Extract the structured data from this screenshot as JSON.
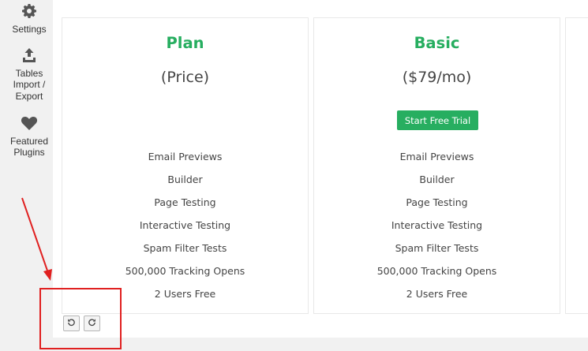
{
  "sidebar": {
    "items": [
      {
        "label": "Settings",
        "icon": "gear-icon"
      },
      {
        "label": "Tables\nImport /\nExport",
        "icon": "upload-icon"
      },
      {
        "label": "Featured\nPlugins",
        "icon": "heart-icon"
      }
    ]
  },
  "pricing": {
    "columns": [
      {
        "title": "Plan",
        "price": "(Price)",
        "features": [
          "Email Previews",
          "Builder",
          "Page Testing",
          "Interactive Testing",
          "Spam Filter Tests",
          "500,000 Tracking Opens",
          "2 Users Free"
        ]
      },
      {
        "title": "Basic",
        "price": "($79/mo)",
        "button_label": "Start Free Trial",
        "features": [
          "Email Previews",
          "Builder",
          "Page Testing",
          "Interactive Testing",
          "Spam Filter Tests",
          "500,000 Tracking Opens",
          "2 Users Free"
        ]
      }
    ]
  },
  "toolbar": {
    "undo_icon": "undo-icon",
    "redo_icon": "redo-icon"
  },
  "colors": {
    "accent_green": "#27ae60",
    "annotation_red": "#e02020"
  }
}
